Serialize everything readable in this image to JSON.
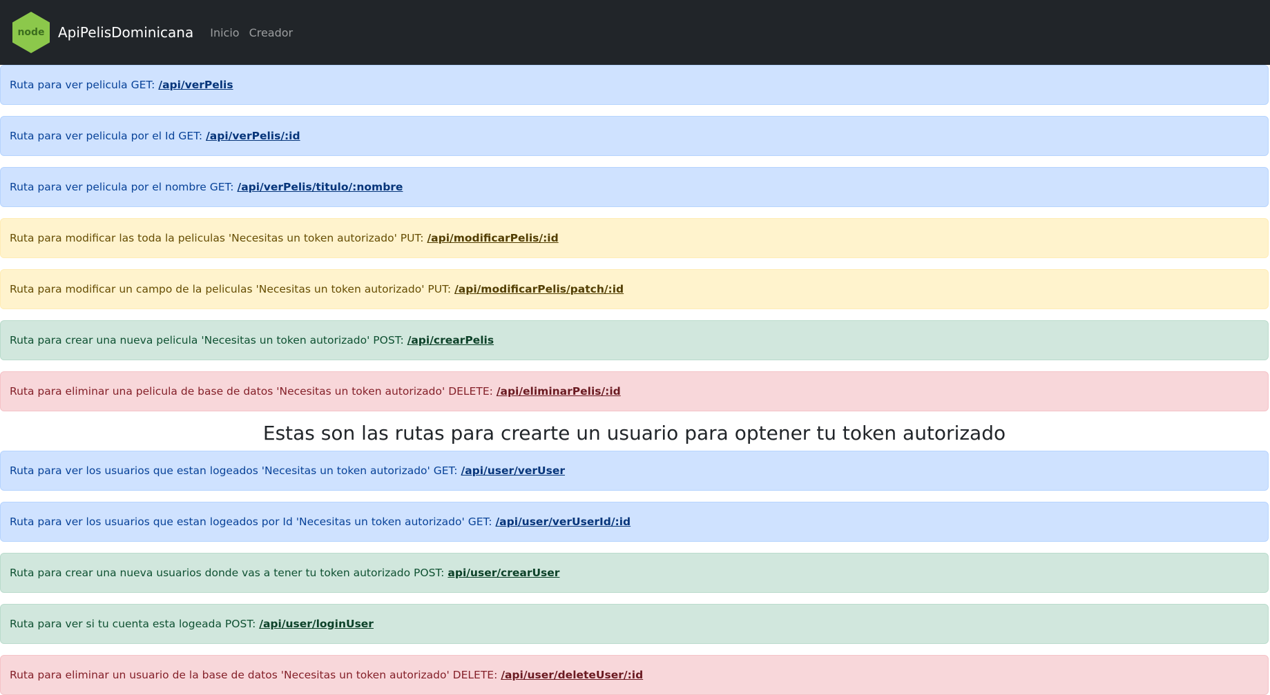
{
  "navbar": {
    "brand": "ApiPelisDominicana",
    "logo_text": "node",
    "links": [
      "Inicio",
      "Creador"
    ]
  },
  "routes_peliculas": [
    {
      "text": "Ruta para ver pelicula GET:",
      "path": "/api/verPelis",
      "variant": "primary"
    },
    {
      "text": "Ruta para ver pelicula por el Id GET:",
      "path": "/api/verPelis/:id",
      "variant": "primary"
    },
    {
      "text": "Ruta para ver pelicula por el nombre GET:",
      "path": "/api/verPelis/titulo/:nombre",
      "variant": "primary"
    },
    {
      "text": "Ruta para modificar las toda la peliculas 'Necesitas un token autorizado' PUT:",
      "path": "/api/modificarPelis/:id",
      "variant": "warning"
    },
    {
      "text": "Ruta para modificar un campo de la peliculas 'Necesitas un token autorizado' PUT:",
      "path": "/api/modificarPelis/patch/:id",
      "variant": "warning"
    },
    {
      "text": "Ruta para crear una nueva pelicula 'Necesitas un token autorizado' POST:",
      "path": "/api/crearPelis",
      "variant": "success"
    },
    {
      "text": "Ruta para eliminar una pelicula de base de datos 'Necesitas un token autorizado' DELETE:",
      "path": "/api/eliminarPelis/:id",
      "variant": "danger"
    }
  ],
  "section_heading": "Estas son las rutas para crearte un usuario para optener tu token autorizado",
  "routes_usuarios": [
    {
      "text": "Ruta para ver los usuarios que estan logeados 'Necesitas un token autorizado' GET:",
      "path": "/api/user/verUser",
      "variant": "primary"
    },
    {
      "text": "Ruta para ver los usuarios que estan logeados por Id 'Necesitas un token autorizado' GET:",
      "path": "/api/user/verUserId/:id",
      "variant": "primary"
    },
    {
      "text": "Ruta para crear una nueva usuarios donde vas a tener tu token autorizado POST:",
      "path": "api/user/crearUser",
      "variant": "success"
    },
    {
      "text": "Ruta para ver si tu cuenta esta logeada POST:",
      "path": "/api/user/loginUser",
      "variant": "success"
    },
    {
      "text": "Ruta para eliminar un usuario de la base de datos 'Necesitas un token autorizado' DELETE:",
      "path": "/api/user/deleteUser/:id",
      "variant": "danger"
    }
  ]
}
